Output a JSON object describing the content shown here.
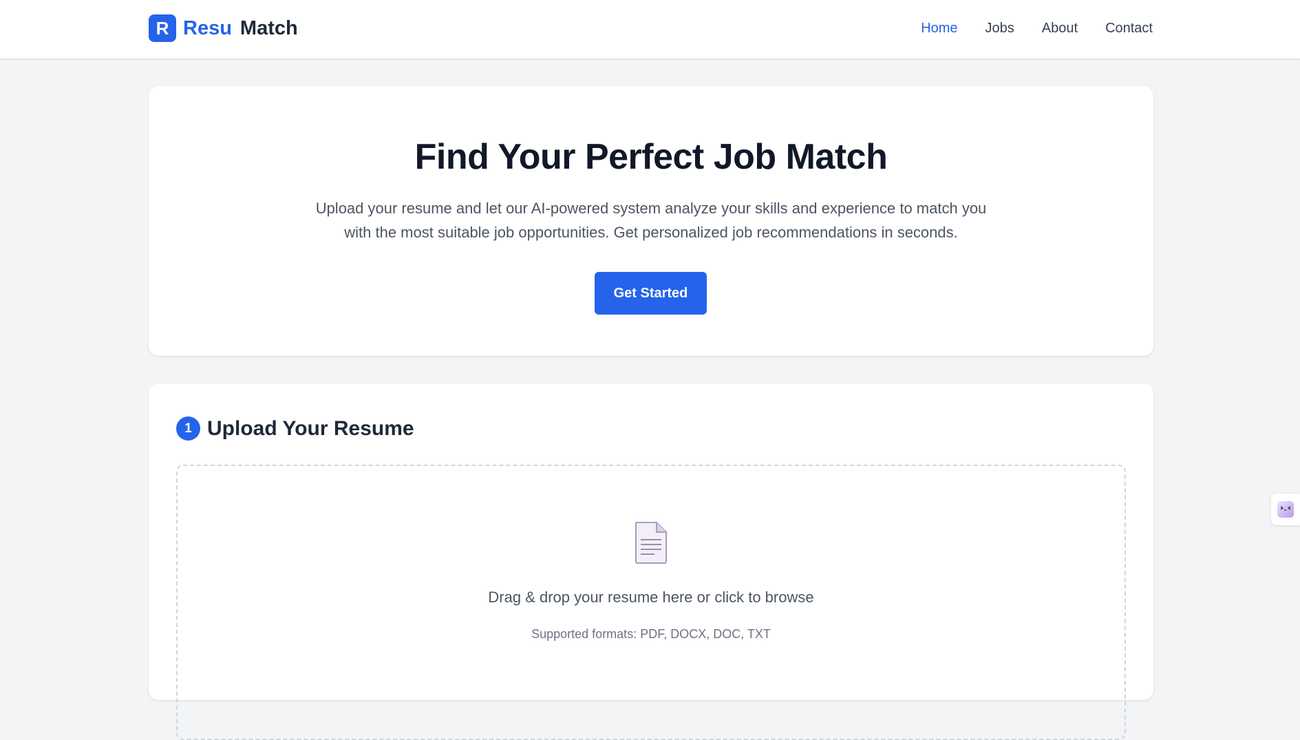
{
  "brand": {
    "logo_letter": "R",
    "name_part1": "Resu",
    "name_part2": "Match"
  },
  "nav": {
    "items": [
      {
        "label": "Home",
        "active": true
      },
      {
        "label": "Jobs",
        "active": false
      },
      {
        "label": "About",
        "active": false
      },
      {
        "label": "Contact",
        "active": false
      }
    ]
  },
  "hero": {
    "title": "Find Your Perfect Job Match",
    "description_line1": "Upload your resume and let our AI-powered system analyze your skills and experience to match you",
    "description_line2": "with the most suitable job opportunities. Get personalized job recommendations in seconds.",
    "cta_label": "Get Started"
  },
  "upload": {
    "step_number": "1",
    "title": "Upload Your Resume",
    "drop_text": "Drag & drop your resume here or click to browse",
    "formats_text": "Supported formats: PDF, DOCX, DOC, TXT",
    "icon": "document-icon"
  },
  "colors": {
    "accent": "#2563eb",
    "background": "#f3f4f6",
    "text_dark": "#111827",
    "text_muted": "#4b5563"
  }
}
